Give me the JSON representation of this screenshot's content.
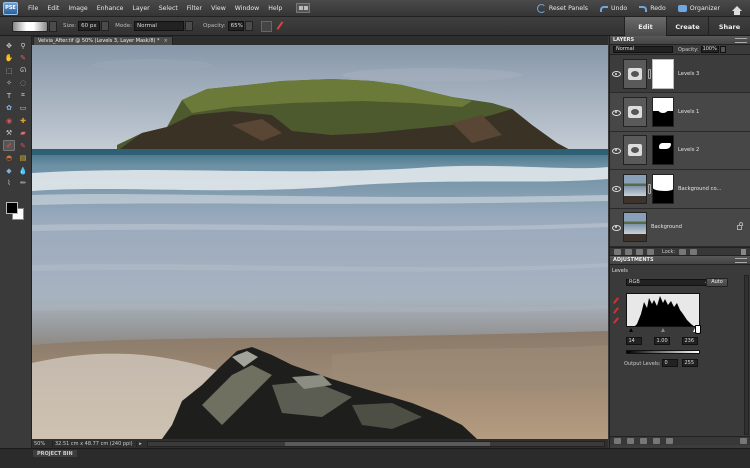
{
  "app": {
    "logo": "PSE"
  },
  "menu": [
    "File",
    "Edit",
    "Image",
    "Enhance",
    "Layer",
    "Select",
    "Filter",
    "View",
    "Window",
    "Help"
  ],
  "menu_right": {
    "reset_panels": "Reset Panels",
    "undo": "Undo",
    "redo": "Redo",
    "organizer": "Organizer"
  },
  "options": {
    "size_label": "Size:",
    "size_value": "60 px",
    "mode_label": "Mode:",
    "mode_value": "Normal",
    "opacity_label": "Opacity:",
    "opacity_value": "65%"
  },
  "mode_tabs": [
    "Edit",
    "Create",
    "Share"
  ],
  "document": {
    "tab_title": "Velvia_After.tif @ 50% (Levels 3, Layer Mask/8) *",
    "close": "×"
  },
  "status": {
    "zoom": "50%",
    "info": "32.51 cm x 48.77 cm (240 ppi)"
  },
  "project_bin": {
    "label": "PROJECT BIN"
  },
  "layers_panel": {
    "title": "LAYERS",
    "blend_mode": "Normal",
    "opacity_label": "Opacity:",
    "opacity_value": "100%",
    "lock_label": "Lock:",
    "layers": [
      {
        "name": "Levels 3",
        "type": "adjustment",
        "active": true
      },
      {
        "name": "Levels 1",
        "type": "adjustment",
        "active": false
      },
      {
        "name": "Levels 2",
        "type": "adjustment",
        "active": false
      },
      {
        "name": "Background co...",
        "type": "photo",
        "active": false
      },
      {
        "name": "Background",
        "type": "photo",
        "active": false,
        "locked": true
      }
    ]
  },
  "adjustments_panel": {
    "title": "ADJUSTMENTS",
    "levels_label": "Levels",
    "channel": "RGB",
    "auto_label": "Auto",
    "input_black": "14",
    "input_gray": "1.00",
    "input_white": "236",
    "output_label": "Output Levels:",
    "output_black": "0",
    "output_white": "255"
  }
}
